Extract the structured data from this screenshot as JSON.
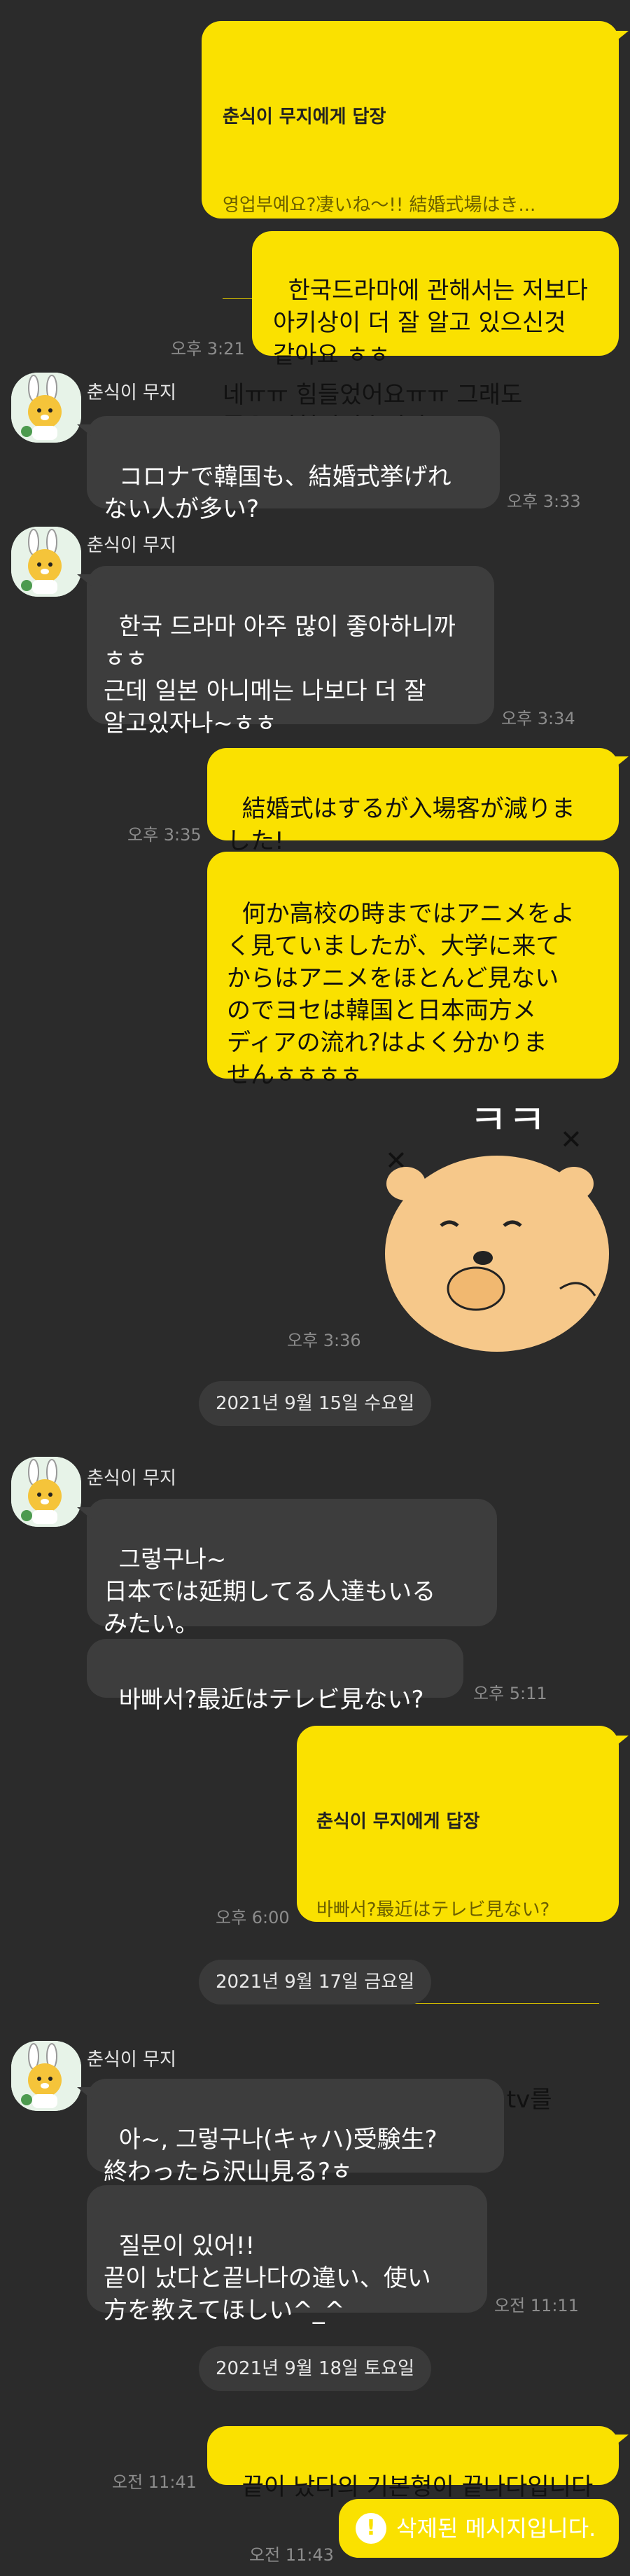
{
  "colors": {
    "my_bubble": "#fae100",
    "their_bubble": "#3d3d3d",
    "background": "#2b2b2b"
  },
  "sender_name": "춘식이 무지",
  "messages": {
    "m1_reply_head": "춘식이 무지에게 답장",
    "m1_reply_quote": "영업부예요?凄いね〜!! 結婚式場はき...",
    "m1_text": "네ㅠㅠ 힘들었어요ㅠㅠ 그래도\n좋은 경험이었습니다!",
    "m2_text": "한국드라마에 관해서는 저보다\n아키상이 더 잘 알고 있으신것\n같아요 ㅎㅎ",
    "m2_time": "오후 3:21",
    "m3_text": "コロナで韓国も、結婚式挙げれ\nない人が多い?",
    "m3_time": "오후 3:33",
    "m4_text": "한국 드라마 아주 많이 좋아하니까\nㅎㅎ\n근데 일본 아니메는 나보다 더 잘\n알고있자나~ㅎㅎ",
    "m4_time": "오후 3:34",
    "m5_text": "結婚式はするが入場客が減りま\nした!",
    "m5_time": "오후 3:35",
    "m6_text": "何か高校の時まではアニメをよ\nく見ていましたが、大学に来て\nからはアニメをほとんど見ない\nのでヨセは韓国と日本両方メ\nディアの流れ?はよく分かりま\nせんㅎㅎㅎㅎ",
    "sticker_text": "ㅋㅋ",
    "m6_time": "오후 3:36",
    "date1": "2021년 9월 15일 수요일",
    "m7_text": "그렇구나~\n日本では延期してる人達もいる\nみたい。",
    "m8_text": "바빠서?最近はテレビ見ない?",
    "m8_time": "오후 5:11",
    "m9_reply_head": "춘식이 무지에게 답장",
    "m9_reply_quote": "바빠서?最近はテレビ見ない?",
    "m9_text": "동생이 공부한다고 tv를\n치웠어요ㅠㅠ",
    "m9_time": "오후 6:00",
    "date2": "2021년 9월 17일 금요일",
    "m10_text": "아~, 그렇구나(キャハ)受験生?\n終わったら沢山見る?ㅎ",
    "m11_text": "질문이 있어!!\n끝이 났다と끝나다の違い、使い\n方を教えてほしい^_^",
    "m11_time": "오전 11:11",
    "date3": "2021년 9월 18일 토요일",
    "m12_text": "끝이 났다의 기본형이 끝나다입니다",
    "m12_time": "오전 11:41",
    "m13_text": "삭제된 메시지입니다.",
    "m13_time": "오전 11:43",
    "alert_icon": "!"
  }
}
